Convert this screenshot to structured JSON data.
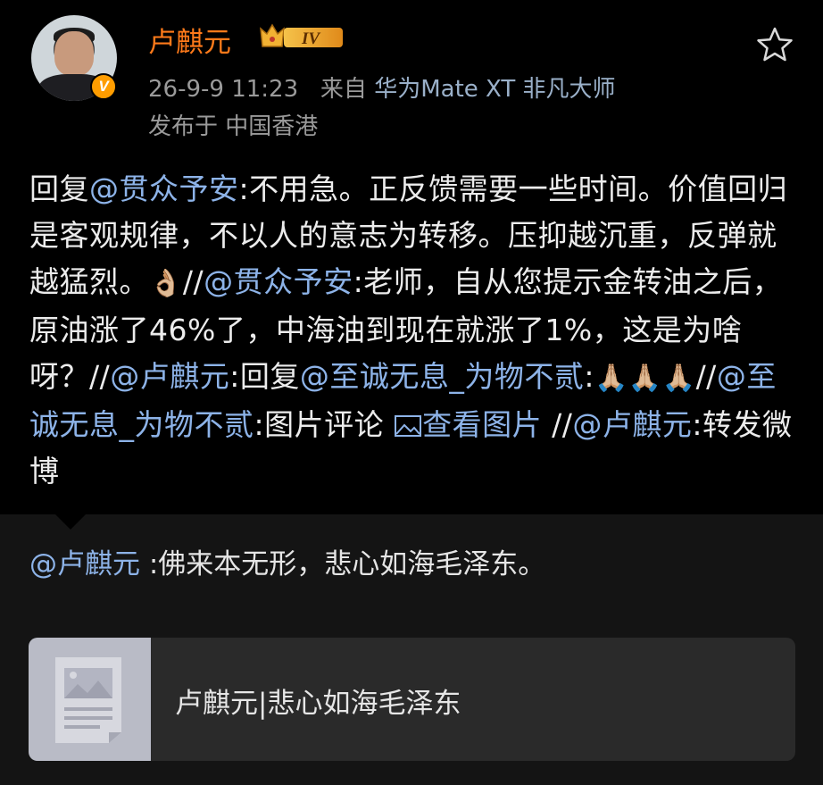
{
  "post": {
    "author": "卢麒元",
    "level_badge": "IV",
    "timestamp": "26-9-9 11:23",
    "source_prefix": "来自",
    "source_device": "华为Mate XT 非凡大师",
    "location": "发布于 中国香港",
    "content": [
      {
        "t": "text",
        "v": "回复"
      },
      {
        "t": "at",
        "v": "@贯众予安"
      },
      {
        "t": "text",
        "v": ":不用急。正反馈需要一些时间。价值回归是客观规律，不以人的意志为转移。压抑越沉重，反弹就越猛烈。"
      },
      {
        "t": "emoji",
        "v": "👌🏼"
      },
      {
        "t": "text",
        "v": "//"
      },
      {
        "t": "at",
        "v": "@贯众予安"
      },
      {
        "t": "text",
        "v": ":老师，自从您提示金转油之后，原油涨了46%了，中海油到现在就涨了1%，这是为啥呀？//"
      },
      {
        "t": "at",
        "v": "@卢麒元"
      },
      {
        "t": "text",
        "v": ":回复"
      },
      {
        "t": "at",
        "v": "@至诚无息_为物不贰"
      },
      {
        "t": "text",
        "v": ":"
      },
      {
        "t": "emoji",
        "v": "🙏🏼🙏🏼🙏🏼"
      },
      {
        "t": "text",
        "v": "//"
      },
      {
        "t": "at",
        "v": "@至诚无息_为物不贰"
      },
      {
        "t": "text",
        "v": ":图片评论 "
      },
      {
        "t": "link",
        "v": "查看图片"
      },
      {
        "t": "text",
        "v": "  //"
      },
      {
        "t": "at",
        "v": "@卢麒元"
      },
      {
        "t": "text",
        "v": ":转发微博"
      }
    ]
  },
  "original": {
    "mention": "@卢麒元",
    "text": " :佛来本无形，悲心如海毛泽东。",
    "card_title": "卢麒元|悲心如海毛泽东"
  },
  "icons": {
    "star": "star-outline-icon",
    "verified": "verified-v-icon",
    "crown": "crown-level-icon",
    "image": "image-icon",
    "thumbnail": "article-thumbnail-icon"
  },
  "colors": {
    "username": "#ff7a1a",
    "mention": "#8db3e8",
    "background": "#000000"
  }
}
